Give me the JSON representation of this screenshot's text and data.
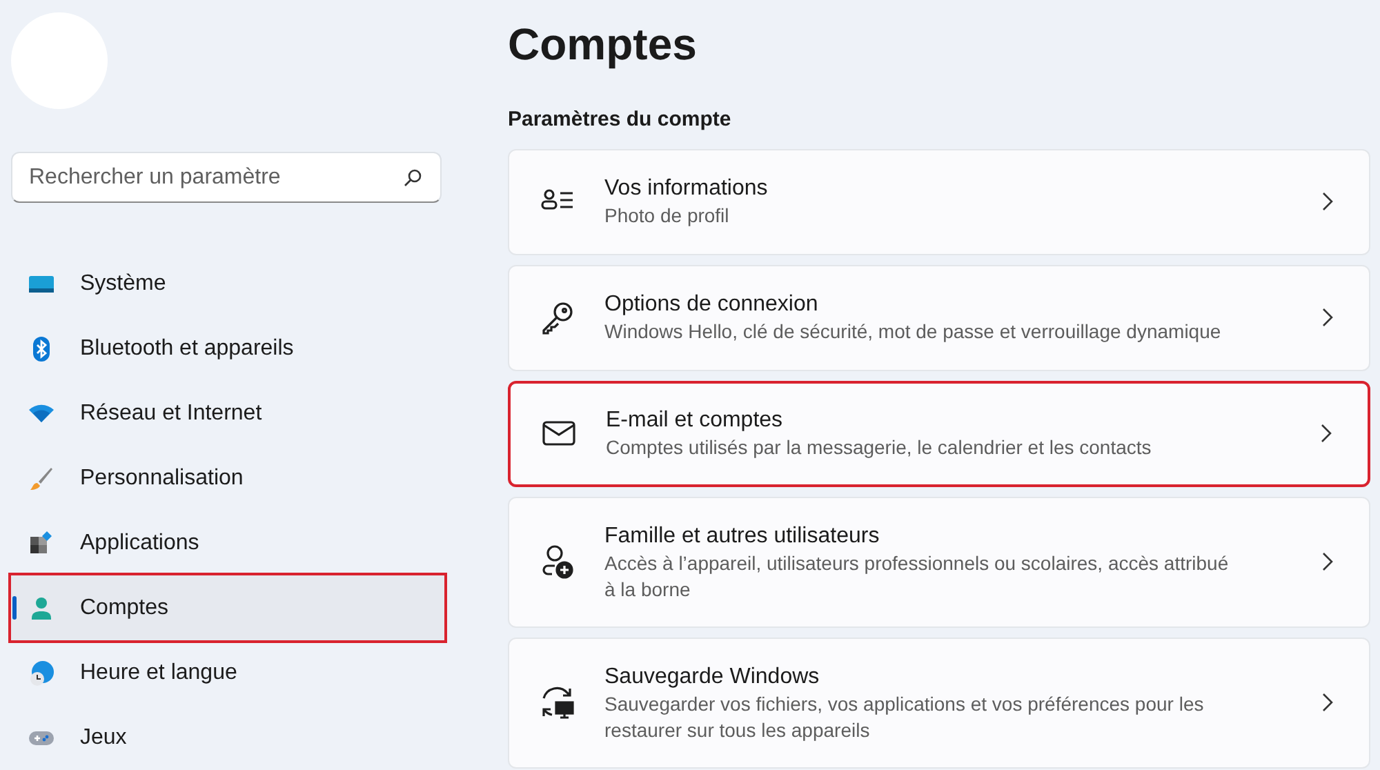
{
  "search": {
    "placeholder": "Rechercher un paramètre"
  },
  "sidebar": {
    "items": [
      {
        "label": "Système",
        "kind": "system",
        "selected": false,
        "highlighted": false
      },
      {
        "label": "Bluetooth et appareils",
        "kind": "bluetooth",
        "selected": false,
        "highlighted": false
      },
      {
        "label": "Réseau et Internet",
        "kind": "wifi",
        "selected": false,
        "highlighted": false
      },
      {
        "label": "Personnalisation",
        "kind": "brush",
        "selected": false,
        "highlighted": false
      },
      {
        "label": "Applications",
        "kind": "apps",
        "selected": false,
        "highlighted": false
      },
      {
        "label": "Comptes",
        "kind": "person",
        "selected": true,
        "highlighted": true
      },
      {
        "label": "Heure et langue",
        "kind": "globe",
        "selected": false,
        "highlighted": false
      },
      {
        "label": "Jeux",
        "kind": "gamepad",
        "selected": false,
        "highlighted": false
      }
    ]
  },
  "page": {
    "title": "Comptes",
    "section": "Paramètres du compte"
  },
  "cards": [
    {
      "title": "Vos informations",
      "subtitle": "Photo de profil",
      "kind": "info",
      "highlighted": false
    },
    {
      "title": "Options de connexion",
      "subtitle": "Windows Hello, clé de sécurité, mot de passe et verrouillage dynamique",
      "kind": "key",
      "highlighted": false
    },
    {
      "title": "E-mail et comptes",
      "subtitle": "Comptes utilisés par la messagerie, le calendrier et les contacts",
      "kind": "mail",
      "highlighted": true
    },
    {
      "title": "Famille et autres utilisateurs",
      "subtitle": "Accès à l’appareil, utilisateurs professionnels ou scolaires, accès attribué à la borne",
      "kind": "family",
      "highlighted": false
    },
    {
      "title": "Sauvegarde Windows",
      "subtitle": "Sauvegarder vos fichiers, vos applications et vos préférences pour les restaurer sur tous les appareils",
      "kind": "backup",
      "highlighted": false
    }
  ]
}
